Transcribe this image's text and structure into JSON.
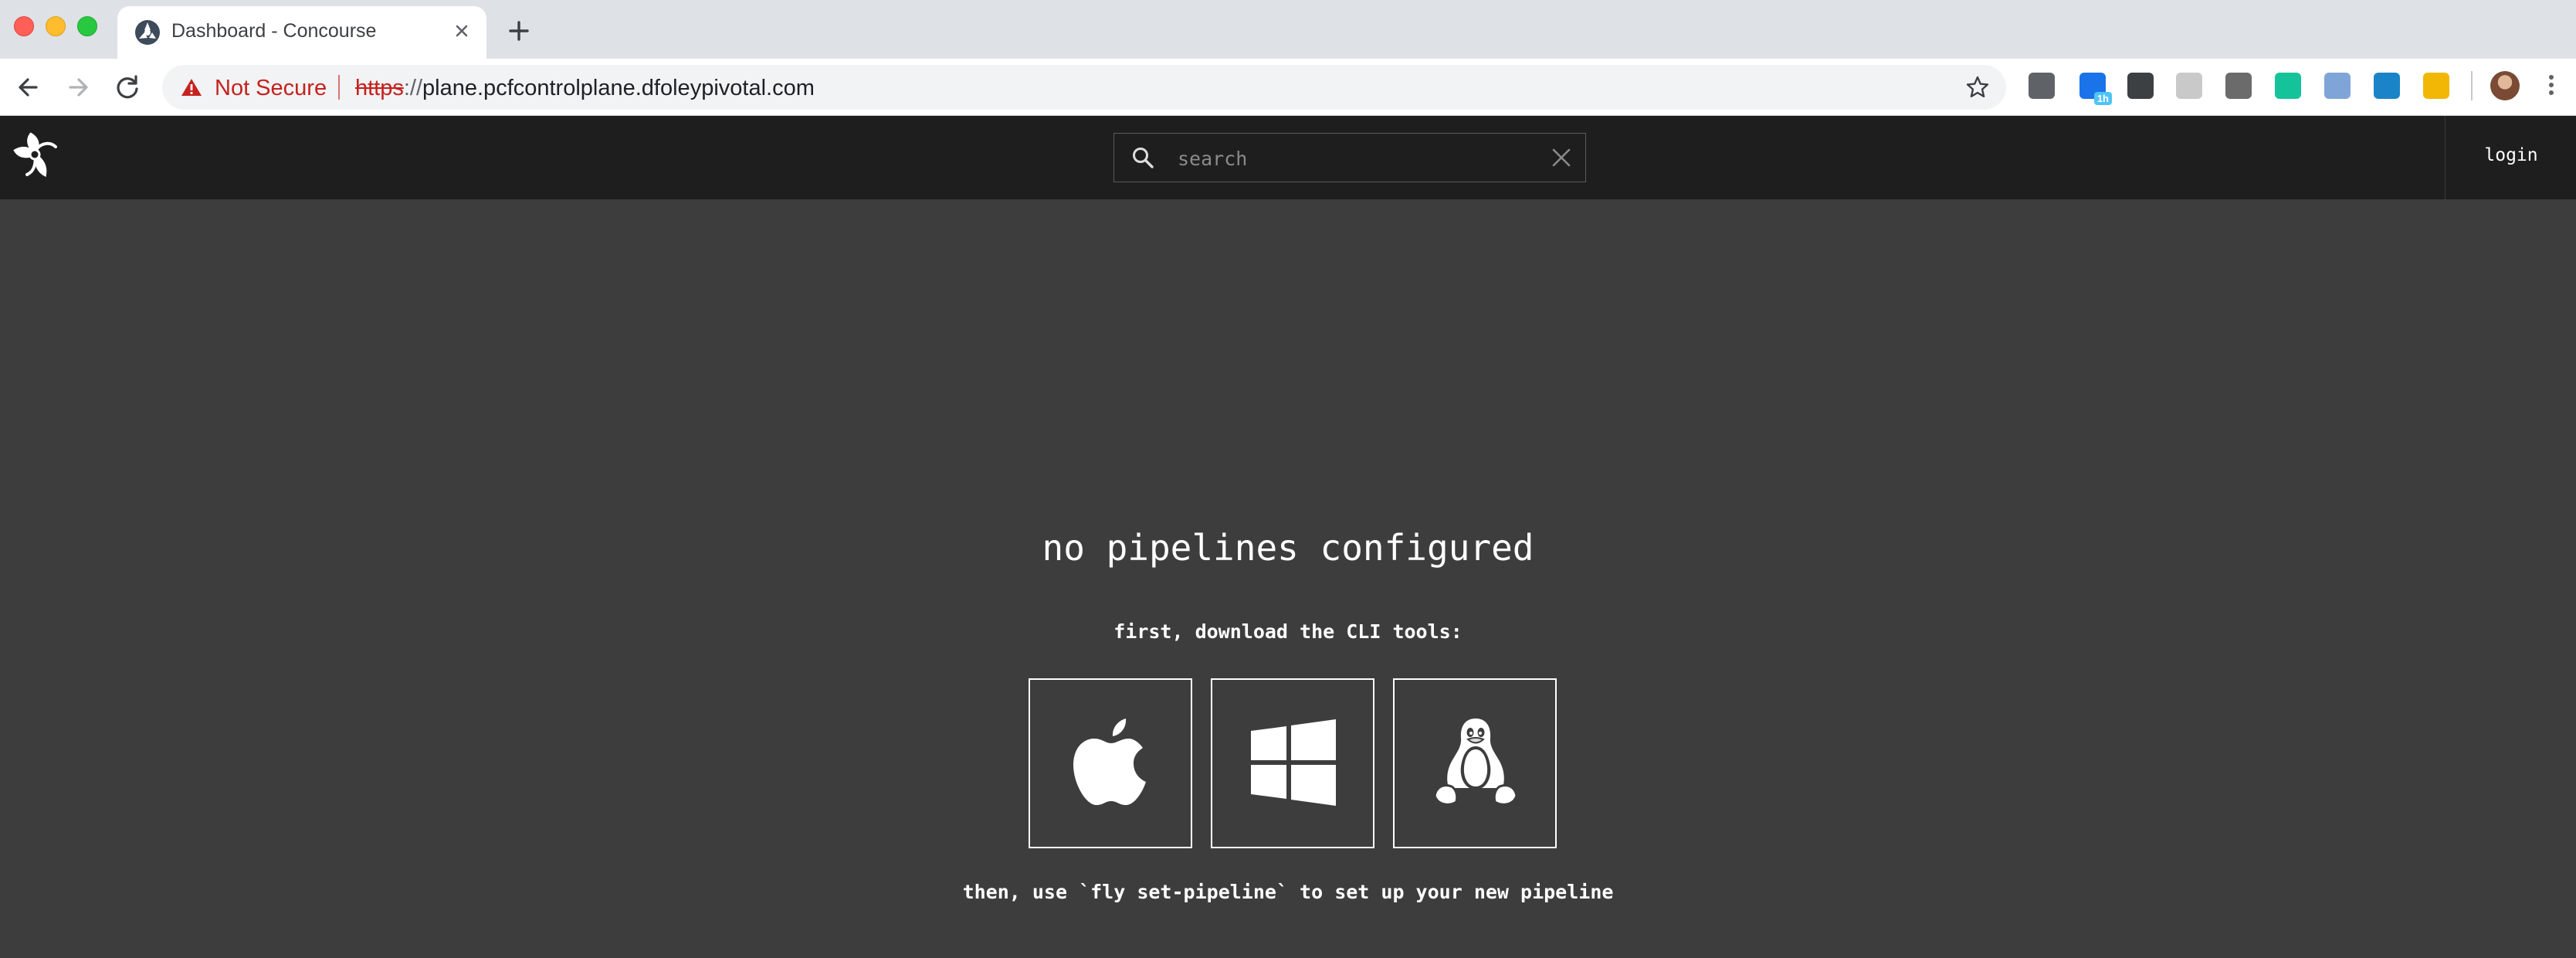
{
  "browser": {
    "tab": {
      "title": "Dashboard - Concourse"
    },
    "address": {
      "security_label": "Not Secure",
      "scheme": "https",
      "separator": "://",
      "host": "plane.pcfcontrolplane.dfoleypivotal.com"
    },
    "extensions": [
      {
        "icon": "lightbulb-extension-icon",
        "color": "#5f6368"
      },
      {
        "icon": "calendar-extension-icon",
        "color": "#1a73e8",
        "badge": "1h"
      },
      {
        "icon": "json-extension-icon",
        "color": "#3c4043"
      },
      {
        "icon": "grid-extension-icon",
        "color": "#c9c9c9"
      },
      {
        "icon": "record-extension-icon",
        "color": "#6b6b6b"
      },
      {
        "icon": "grammarly-extension-icon",
        "color": "#15c39a"
      },
      {
        "icon": "pen-extension-icon",
        "color": "#7fa4d8"
      },
      {
        "icon": "ring-extension-icon",
        "color": "#1b84c8"
      },
      {
        "icon": "dots-extension-icon",
        "color": "#f2b705"
      }
    ]
  },
  "app": {
    "search": {
      "placeholder": "search"
    },
    "login_label": "login",
    "empty_state": {
      "title": "no pipelines configured",
      "subtitle": "first, download the CLI tools:",
      "downloads": [
        {
          "platform": "osx",
          "icon": "apple-icon"
        },
        {
          "platform": "windows",
          "icon": "windows-icon"
        },
        {
          "platform": "linux",
          "icon": "linux-tux-icon"
        }
      ],
      "hint": "then, use `fly set-pipeline` to set up your new pipeline"
    },
    "colors": {
      "topbar": "#1e1e1e",
      "background": "#3d3d3d",
      "text": "#ffffff"
    }
  }
}
